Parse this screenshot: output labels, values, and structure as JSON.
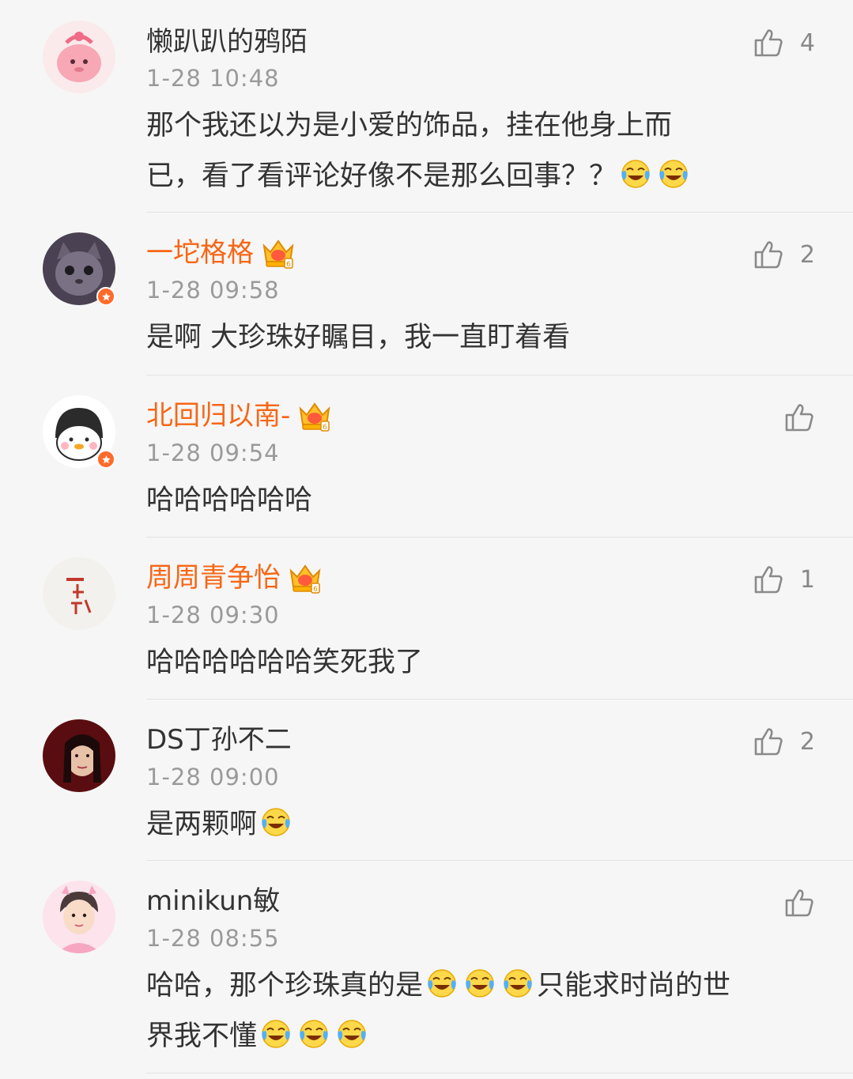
{
  "comments": [
    {
      "username": "懒趴趴的鸦陌",
      "vip_name": false,
      "crown": false,
      "verified": false,
      "avatar": "pink-cartoon-avatar",
      "time": "1-28 10:48",
      "likes": "4",
      "lines": [
        [
          {
            "t": "那个我还以为是小爱的饰品，挂在他身上而"
          }
        ],
        [
          {
            "t": "已，看了看评论好像不是那么回事？？"
          },
          {
            "e": "laugh-cry-emoji"
          },
          {
            "e": "laugh-cry-emoji"
          }
        ]
      ]
    },
    {
      "username": "一坨格格",
      "vip_name": true,
      "crown": true,
      "verified": true,
      "avatar": "grey-cat-avatar",
      "time": "1-28 09:58",
      "likes": "2",
      "lines": [
        [
          {
            "t": "是啊 大珍珠好瞩目，我一直盯着看"
          }
        ]
      ]
    },
    {
      "username": "北回归以南-",
      "vip_name": true,
      "crown": true,
      "verified": true,
      "avatar": "duck-girl-avatar",
      "time": "1-28 09:54",
      "likes": "",
      "lines": [
        [
          {
            "t": "哈哈哈哈哈哈"
          }
        ]
      ]
    },
    {
      "username": "周周青争怡",
      "vip_name": true,
      "crown": true,
      "verified": false,
      "avatar": "calligraphy-avatar",
      "time": "1-28 09:30",
      "likes": "1",
      "lines": [
        [
          {
            "t": "哈哈哈哈哈哈笑死我了"
          }
        ]
      ]
    },
    {
      "username": "DS丁孙不二",
      "vip_name": false,
      "crown": false,
      "verified": false,
      "avatar": "red-portrait-avatar",
      "time": "1-28 09:00",
      "likes": "2",
      "lines": [
        [
          {
            "t": "是两颗啊"
          },
          {
            "e": "laugh-cry-emoji"
          }
        ]
      ]
    },
    {
      "username": "minikun敏",
      "vip_name": false,
      "crown": false,
      "verified": false,
      "avatar": "pink-boy-avatar",
      "time": "1-28 08:55",
      "likes": "",
      "lines": [
        [
          {
            "t": "哈哈，那个珍珠真的是"
          },
          {
            "e": "laugh-cry-emoji"
          },
          {
            "e": "laugh-cry-emoji"
          },
          {
            "e": "laugh-cry-emoji"
          },
          {
            "t": "只能求时尚的世"
          }
        ],
        [
          {
            "t": "界我不懂"
          },
          {
            "e": "laugh-cry-emoji"
          },
          {
            "e": "laugh-cry-emoji"
          },
          {
            "e": "laugh-cry-emoji"
          }
        ]
      ]
    }
  ],
  "colors": {
    "background": "#f6f6f6",
    "vip_name": "#f86615",
    "username": "#333333",
    "time": "#9a9a9a",
    "like_icon": "#8a8a8a",
    "verified_badge": "#ff6a2a"
  }
}
